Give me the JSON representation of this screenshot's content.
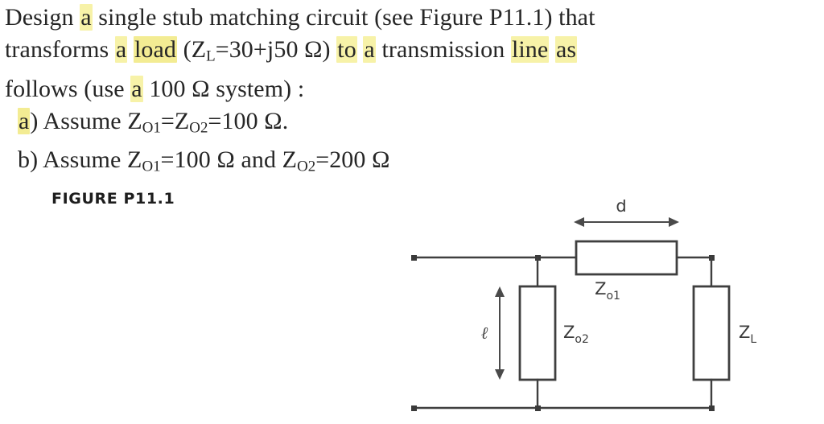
{
  "document": {
    "background_color": "#ffffff",
    "text_color": "#262626",
    "highlight_color": "#f7f2a8"
  },
  "problem": {
    "line1": {
      "seg1": "Design",
      "hl1": "a",
      "seg2": "single stub matching circuit (see Figure P11.1) that"
    },
    "line2": {
      "seg1": "transforms",
      "hl1": "a",
      "hl2": "load",
      "seg2": "(Z",
      "sub1": "L",
      "seg3": "=30+j50 Ω)",
      "hl3": "to",
      "hl4": "a",
      "seg4": "transmission",
      "hl5": "line",
      "hl6": "as"
    },
    "line3": {
      "seg1": "follows (use",
      "hl1": "a",
      "seg2": "100 Ω system) :"
    },
    "line4": {
      "hl1": "a",
      "seg1": ") Assume Z",
      "sub1": "O1",
      "seg2": "=Z",
      "sub2": "O2",
      "seg3": "=100 Ω."
    },
    "line5": {
      "seg1": "b) Assume Z",
      "sub1": "O1",
      "seg2": "=100 Ω and Z",
      "sub2": "O2",
      "seg3": "=200 Ω"
    }
  },
  "figure": {
    "caption": "FIGURE P11.1",
    "labels": {
      "d": "d",
      "ell": "ℓ",
      "z_o1_base": "Z",
      "z_o1_sub": "o1",
      "z_o2_base": "Z",
      "z_o2_sub": "o2",
      "z_l_base": "Z",
      "z_l_sub": "L"
    },
    "line_color": "#3f3f3f"
  }
}
